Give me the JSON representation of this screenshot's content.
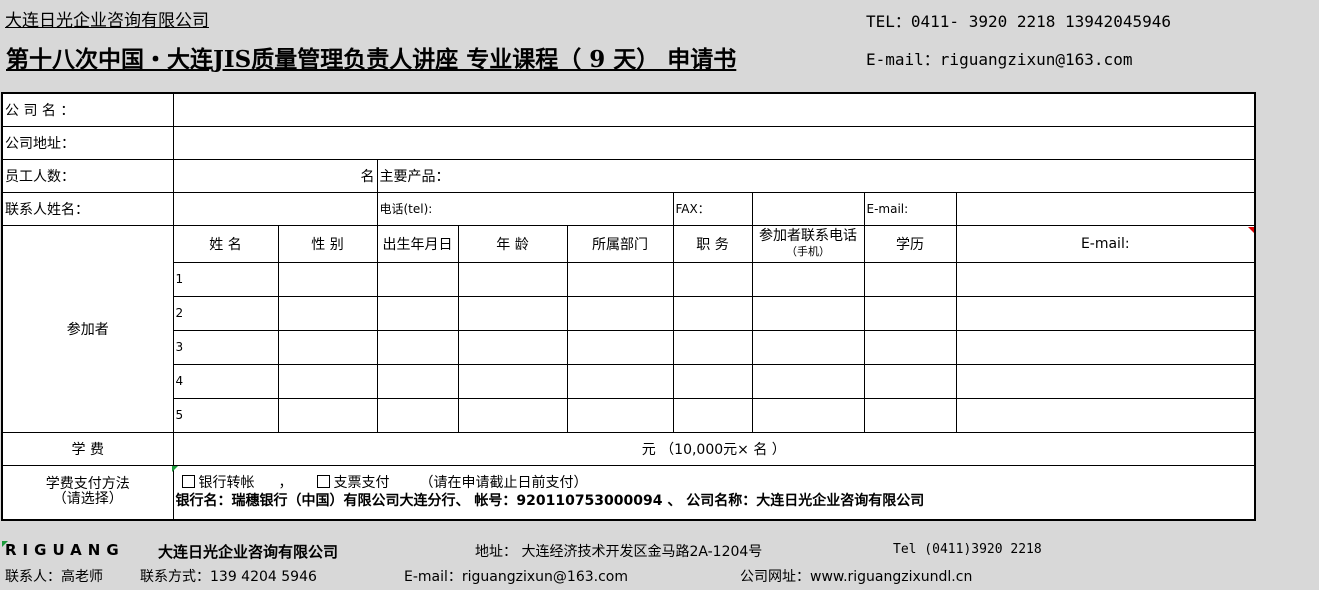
{
  "header": {
    "company": "大连日光企业咨询有限公司",
    "tel": "TEL：0411- 3920 2218 13942045946",
    "title": "第十八次中国・大连JIS质量管理负责人讲座 专业课程（ 9 天）  申请书",
    "email": "E-mail：riguangzixun@163.com"
  },
  "form": {
    "company_name_label": "公 司 名 ：",
    "company_address_label": "公司地址：",
    "employees_label": "员工人数：",
    "employees_unit": "名",
    "main_products_label": "主要产品：",
    "contact_name_label": "联系人姓名：",
    "phone_label": "电话(tel):",
    "fax_label": "FAX：",
    "email_label": "E-mail:",
    "participants_label": "参加者",
    "columns": [
      "姓 名",
      "性 别",
      "出生年月日",
      "年 龄",
      "所属部门",
      "职 务",
      "参加者联系电话",
      "学历",
      "E-mail:"
    ],
    "phone_col_sub": "（手机）",
    "rows": [
      "1",
      "2",
      "3",
      "4",
      "5"
    ],
    "fee_label": "学 费",
    "fee_text": "元    （10,000元×       名  ）",
    "payment_label": "学费支付方法",
    "payment_sub": "（请选择）",
    "payment_opt1": "银行转帐",
    "payment_sep": "，",
    "payment_opt2": "支票支付",
    "payment_note": "（请在申请截止日前支付）",
    "bank_info": "银行名：瑞穗银行（中国）有限公司大连分行、     帐号：920110753000094  、 公司名称：大连日光企业咨询有限公司"
  },
  "footer": {
    "brand": "RIGUANG",
    "company": "大连日光企业咨询有限公司",
    "address": "地址：  大连经济技术开发区金马路2A-1204号",
    "tel": "Tel (0411)3920 2218",
    "contact": "联系人：高老师",
    "contact_phone": "联系方式：139 4204 5946",
    "email": "E-mail：riguangzixun@163.com",
    "website": "公司网址：www.riguangzixundl.cn"
  }
}
